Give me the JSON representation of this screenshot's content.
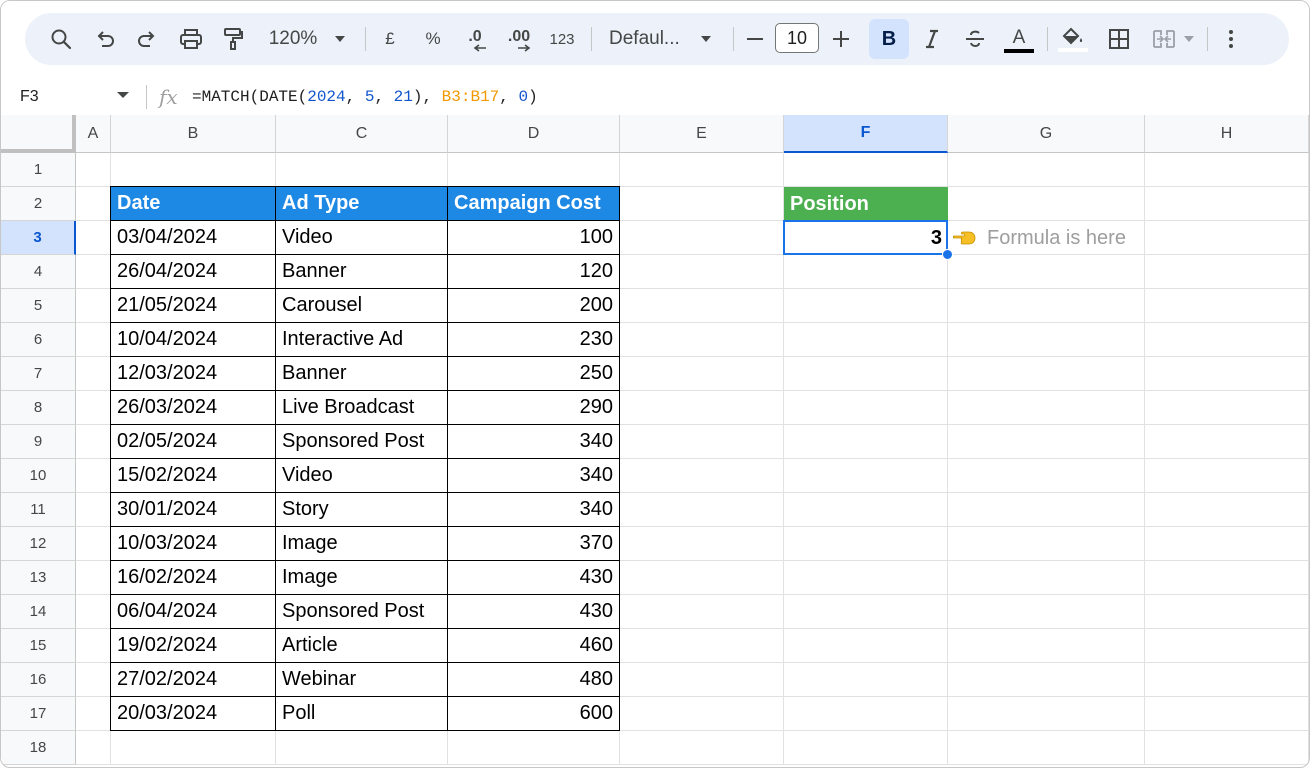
{
  "toolbar": {
    "zoom": "120%",
    "currency": "£",
    "percent": "%",
    "decrease_decimal": ".0",
    "increase_decimal": ".00",
    "number_format": "123",
    "font_name": "Defaul...",
    "font_size": "10",
    "bold_label": "B",
    "text_color_label": "A",
    "icons": [
      "search-icon",
      "undo-icon",
      "redo-icon",
      "print-icon",
      "paint-format-icon",
      "zoom-dropdown-icon",
      "font-dropdown-icon",
      "decrease-font-icon",
      "increase-font-icon",
      "italic-icon",
      "strikethrough-icon",
      "text-color-icon",
      "fill-color-icon",
      "borders-icon",
      "merge-cells-icon",
      "more-options-icon"
    ]
  },
  "formula_bar": {
    "cell_ref": "F3",
    "fx_label": "fx",
    "formula_parts": [
      {
        "text": "=MATCH(DATE(",
        "kind": "plain"
      },
      {
        "text": "2024",
        "kind": "num"
      },
      {
        "text": ", ",
        "kind": "plain"
      },
      {
        "text": "5",
        "kind": "num"
      },
      {
        "text": ", ",
        "kind": "plain"
      },
      {
        "text": "21",
        "kind": "num"
      },
      {
        "text": "), ",
        "kind": "plain"
      },
      {
        "text": "B3:B17",
        "kind": "range"
      },
      {
        "text": ", ",
        "kind": "plain"
      },
      {
        "text": "0",
        "kind": "num"
      },
      {
        "text": ")",
        "kind": "plain"
      }
    ]
  },
  "sheet": {
    "columns": [
      "A",
      "B",
      "C",
      "D",
      "E",
      "F",
      "G",
      "H"
    ],
    "selected_column": "F",
    "rows": [
      "1",
      "2",
      "3",
      "4",
      "5",
      "6",
      "7",
      "8",
      "9",
      "10",
      "11",
      "12",
      "13",
      "14",
      "15",
      "16",
      "17",
      "18"
    ],
    "selected_row": "3",
    "table": {
      "headers": [
        "Date",
        "Ad Type",
        "Campaign Cost"
      ],
      "rows": [
        [
          "03/04/2024",
          "Video",
          "100"
        ],
        [
          "26/04/2024",
          "Banner",
          "120"
        ],
        [
          "21/05/2024",
          "Carousel",
          "200"
        ],
        [
          "10/04/2024",
          "Interactive Ad",
          "230"
        ],
        [
          "12/03/2024",
          "Banner",
          "250"
        ],
        [
          "26/03/2024",
          "Live Broadcast",
          "290"
        ],
        [
          "02/05/2024",
          "Sponsored Post",
          "340"
        ],
        [
          "15/02/2024",
          "Video",
          "340"
        ],
        [
          "30/01/2024",
          "Story",
          "340"
        ],
        [
          "10/03/2024",
          "Image",
          "370"
        ],
        [
          "16/02/2024",
          "Image",
          "430"
        ],
        [
          "06/04/2024",
          "Sponsored Post",
          "430"
        ],
        [
          "19/02/2024",
          "Article",
          "460"
        ],
        [
          "27/02/2024",
          "Webinar",
          "480"
        ],
        [
          "20/03/2024",
          "Poll",
          "600"
        ]
      ]
    },
    "result": {
      "header": "Position",
      "value": "3",
      "note": "Formula is here"
    }
  },
  "colors": {
    "table_header": "#1e88e5",
    "position_header": "#4caf50",
    "selection": "#1a73e8",
    "formula_number": "#1155cc",
    "formula_range": "#f29900"
  }
}
